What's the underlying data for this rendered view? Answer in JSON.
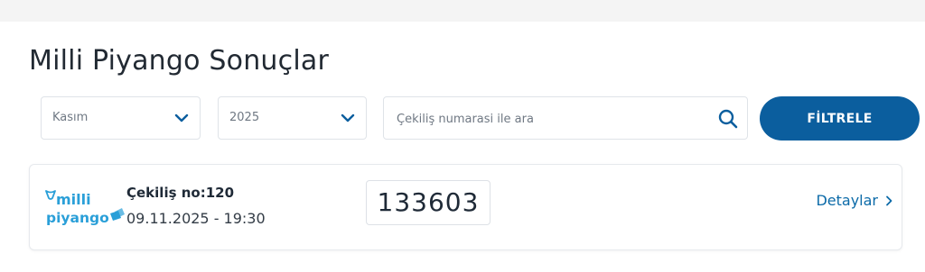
{
  "page": {
    "title": "Milli Piyango Sonuçlar"
  },
  "filters": {
    "month": "Kasım",
    "year": "2025",
    "search_placeholder": "Çekiliş numarasi ile ara",
    "filter_button": "FİLTRELE"
  },
  "result": {
    "logo_text_top": "milli",
    "logo_text_bottom": "piyango",
    "draw_label": "Çekiliş no:120",
    "draw_date": "09.11.2025 - 19:30",
    "winning_number": "133603",
    "details_label": "Detaylar"
  },
  "colors": {
    "brand_blue": "#0b5e9e",
    "logo_blue": "#2a9fd8",
    "text_dark": "#1f2a37"
  },
  "icons": {
    "select_chevron": "chevron-down-icon",
    "search": "search-icon",
    "details_arrow": "chevron-right-icon"
  }
}
